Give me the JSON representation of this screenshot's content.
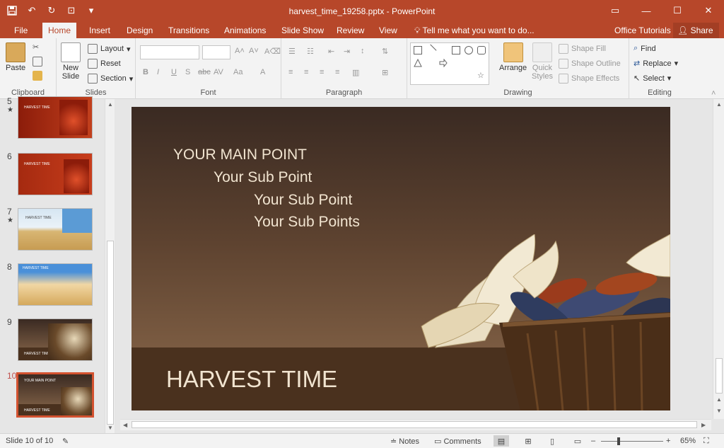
{
  "app": {
    "doc_title": "harvest_time_19258.pptx - PowerPoint"
  },
  "tabs": [
    {
      "label": "File"
    },
    {
      "label": "Home"
    },
    {
      "label": "Insert"
    },
    {
      "label": "Design"
    },
    {
      "label": "Transitions"
    },
    {
      "label": "Animations"
    },
    {
      "label": "Slide Show"
    },
    {
      "label": "Review"
    },
    {
      "label": "View"
    }
  ],
  "tell_me": "Tell me what you want to do...",
  "office_tutorials": "Office Tutorials",
  "share": "Share",
  "ribbon": {
    "clipboard": {
      "label": "Clipboard",
      "paste": "Paste"
    },
    "slides": {
      "label": "Slides",
      "new_slide_1": "New",
      "new_slide_2": "Slide",
      "layout": "Layout",
      "reset": "Reset",
      "section": "Section"
    },
    "font": {
      "label": "Font"
    },
    "paragraph": {
      "label": "Paragraph"
    },
    "drawing": {
      "label": "Drawing",
      "arrange": "Arrange",
      "quick_styles_1": "Quick",
      "quick_styles_2": "Styles",
      "shape_fill": "Shape Fill",
      "shape_outline": "Shape Outline",
      "shape_effects": "Shape Effects"
    },
    "editing": {
      "label": "Editing",
      "find": "Find",
      "replace": "Replace",
      "select": "Select"
    }
  },
  "thumbnails": [
    {
      "num": "5",
      "star": "★",
      "title": "HARVEST TIME"
    },
    {
      "num": "6",
      "star": "",
      "title": "HARVEST TIME"
    },
    {
      "num": "7",
      "star": "★",
      "title": "HARVEST TIME"
    },
    {
      "num": "8",
      "star": "",
      "title": "HARVEST TIME"
    },
    {
      "num": "9",
      "star": "",
      "title": "HARVEST TIME"
    },
    {
      "num": "10",
      "star": "",
      "title": "HARVEST TIME"
    }
  ],
  "slide": {
    "main_point": "YOUR MAIN POINT",
    "sub_point_1": "Your Sub Point",
    "sub_point_2": "Your Sub Point",
    "sub_point_3": "Your Sub Points",
    "title": "HARVEST TIME"
  },
  "status": {
    "slide_count": "Slide 10 of 10",
    "notes": "Notes",
    "comments": "Comments",
    "zoom": "65%"
  },
  "colors": {
    "accent": "#b7472a",
    "current_thumb_border": "#d35230"
  }
}
